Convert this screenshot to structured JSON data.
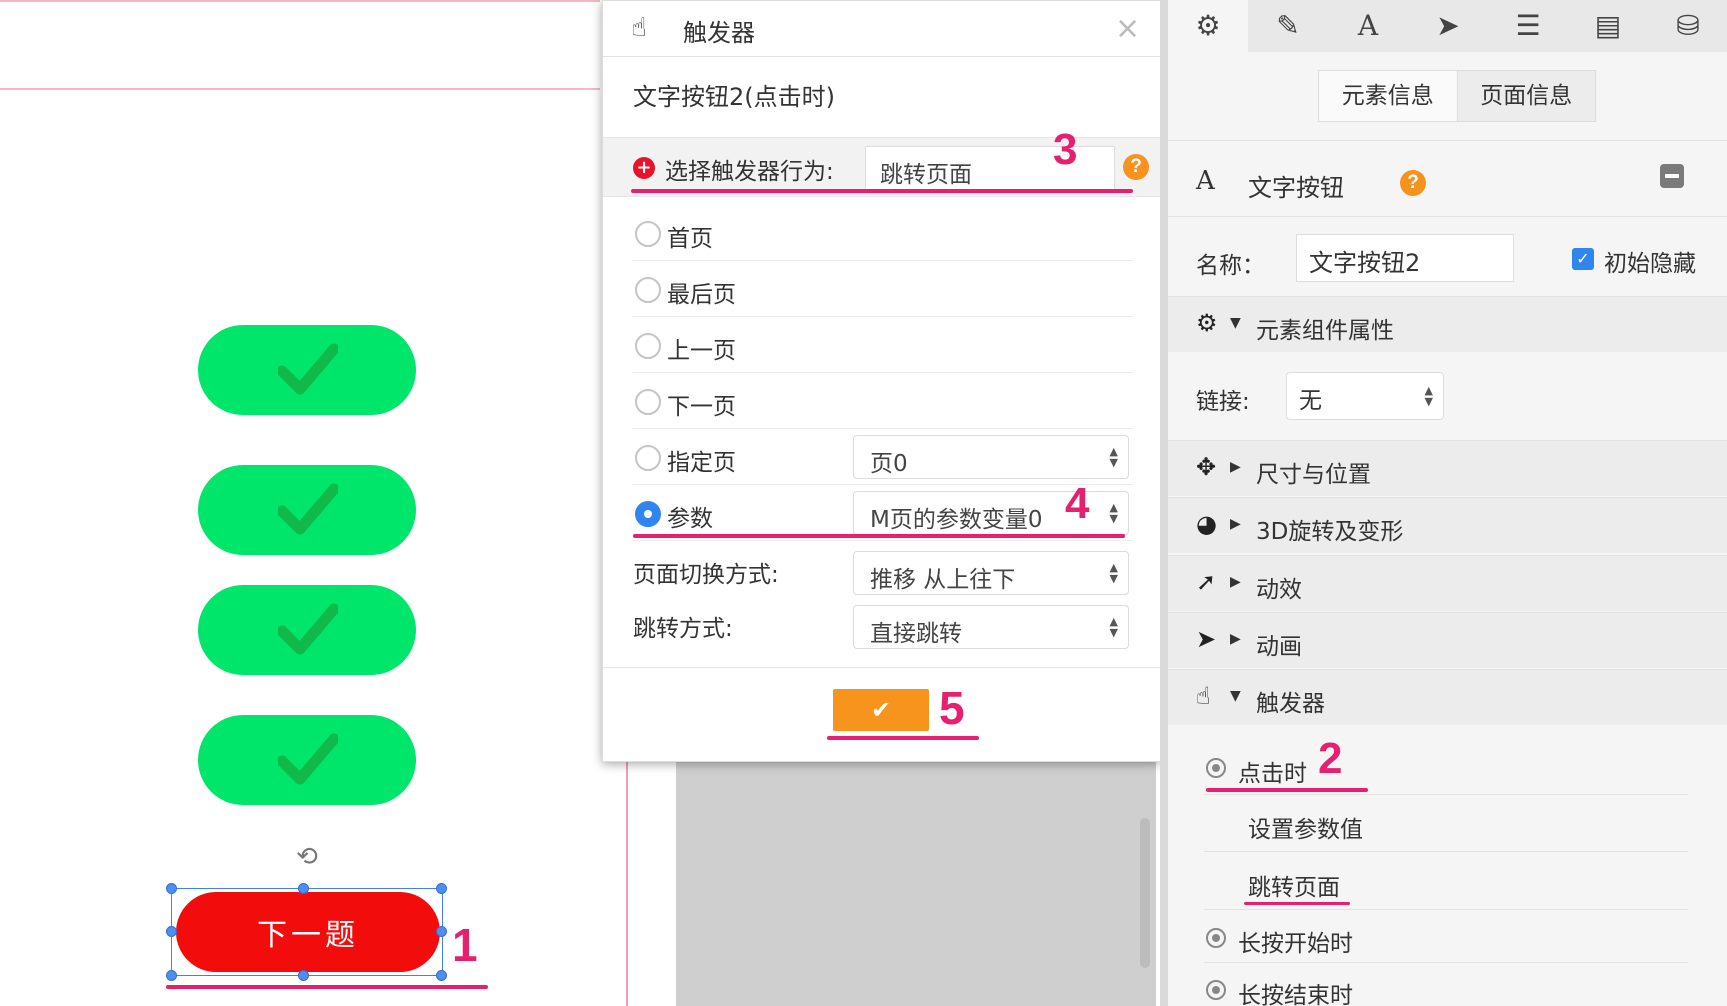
{
  "canvas": {
    "next_button_label": "下一题",
    "rotate_symbol": "⟲"
  },
  "annotations": {
    "step1": "1",
    "step2": "2",
    "step3": "3",
    "step4": "4",
    "step5": "5",
    "color": "#e6206f"
  },
  "dialog": {
    "title": "触发器",
    "close_symbol": "×",
    "subtitle": "文字按钮2(点击时)",
    "behavior_label": "选择触发器行为:",
    "behavior_value": "跳转页面",
    "help_symbol": "?",
    "options": [
      {
        "label": "首页",
        "selected": false
      },
      {
        "label": "最后页",
        "selected": false
      },
      {
        "label": "上一页",
        "selected": false
      },
      {
        "label": "下一页",
        "selected": false
      },
      {
        "label": "指定页",
        "selected": false,
        "select_value": "页0"
      },
      {
        "label": "参数",
        "selected": true,
        "select_value": "M页的参数变量0"
      }
    ],
    "transition_label": "页面切换方式:",
    "transition_value": "推移 从上往下",
    "jump_label": "跳转方式:",
    "jump_value": "直接跳转",
    "ok_symbol": "✔",
    "accent": "#f7941d"
  },
  "panel": {
    "toolbar_icons": [
      "gear-icon",
      "pencil-icon",
      "text-icon",
      "send-icon",
      "list-icon",
      "document-icon",
      "database-icon"
    ],
    "toolbar_glyphs": [
      "⚙",
      "✎",
      "A",
      "➤",
      "☰",
      "▤",
      "⛁"
    ],
    "tabs": [
      "元素信息",
      "页面信息"
    ],
    "element_type_glyph": "A",
    "element_type": "文字按钮",
    "name_label": "名称：",
    "name_value": "文字按钮2",
    "initial_hidden_label": "初始隐藏",
    "initial_hidden": true,
    "sections": {
      "component": "元素组件属性",
      "link_label": "链接:",
      "link_value": "无",
      "size": "尺寸与位置",
      "rotate3d": "3D旋转及变形",
      "effects": "动效",
      "animation": "动画",
      "trigger": "触发器"
    },
    "section_glyphs": {
      "component": "⚙",
      "size": "✥",
      "rotate3d": "◕",
      "effects": "➚",
      "animation": "➤",
      "trigger": "☝"
    },
    "triggers": {
      "on_click": "点击时",
      "actions": [
        "设置参数值",
        "跳转页面"
      ],
      "long_press_start": "长按开始时",
      "long_press_end": "长按结束时"
    }
  }
}
